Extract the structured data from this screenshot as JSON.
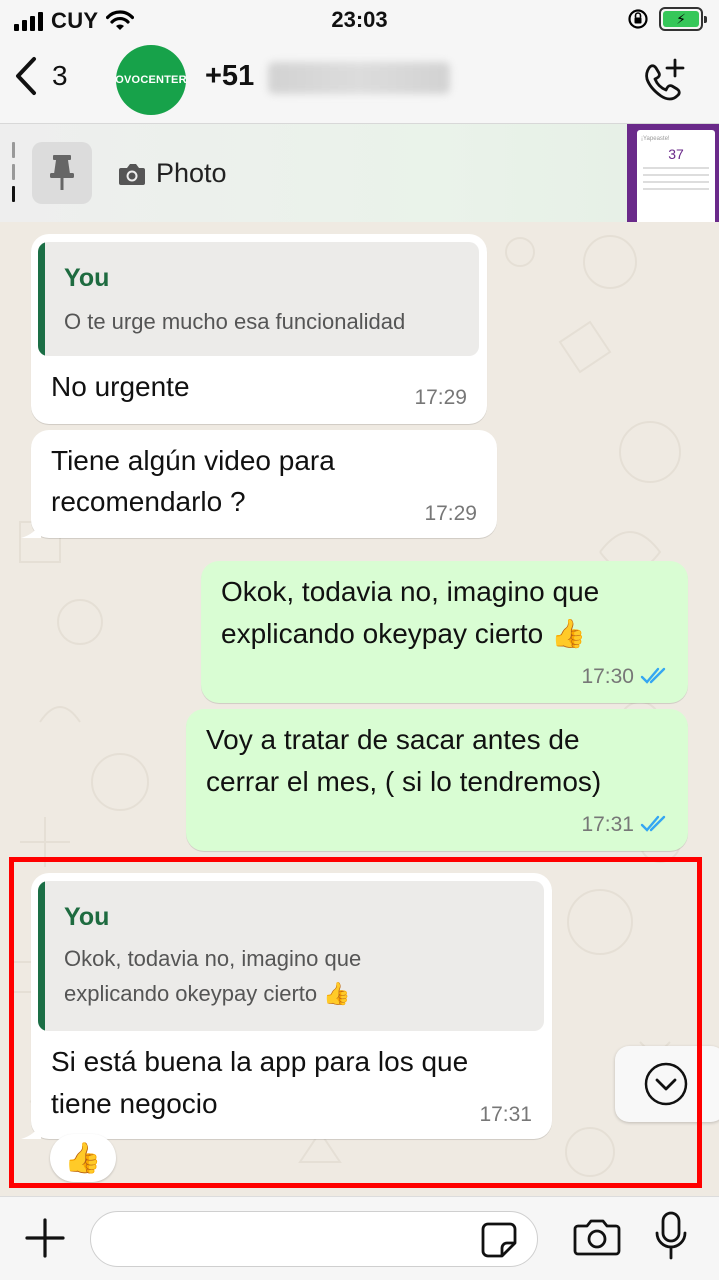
{
  "status_bar": {
    "carrier": "CUY",
    "time": "23:03",
    "battery_charging": true
  },
  "header": {
    "back_count": "3",
    "avatar_text": "OVOCENTER",
    "contact_name": "+51"
  },
  "pinned": {
    "preview_label": "Photo",
    "thumb_number": "37"
  },
  "messages": [
    {
      "id": "m1",
      "direction": "in",
      "quote_author": "You",
      "quote_text": "O te urge mucho esa funcionalidad",
      "text": "No urgente",
      "time": "17:29"
    },
    {
      "id": "m2",
      "direction": "in",
      "text_line1": "Tiene algún video para",
      "text_line2": "recomendarlo ?",
      "time": "17:29"
    },
    {
      "id": "m3",
      "direction": "out",
      "text_line1": "Okok, todavia no, imagino que",
      "text_line2": "explicando okeypay cierto 👍",
      "time": "17:30",
      "status": "read"
    },
    {
      "id": "m4",
      "direction": "out",
      "text_line1": "Voy a tratar de sacar antes de",
      "text_line2": "cerrar el mes, ( si lo tendremos)",
      "time": "17:31",
      "status": "read"
    },
    {
      "id": "m5",
      "direction": "in",
      "quote_author": "You",
      "quote_line1": "Okok, todavia no, imagino que",
      "quote_line2": "explicando okeypay cierto 👍",
      "text_line1": "Si está buena la app para los que",
      "text_line2": "tiene negocio",
      "time": "17:31",
      "reaction": "👍"
    }
  ],
  "composer": {
    "value": "",
    "placeholder": ""
  },
  "colors": {
    "outgoing_bubble": "#d9fdd3",
    "incoming_bubble": "#ffffff",
    "quote_accent": "#1b6e45",
    "read_ticks": "#34a6f2",
    "highlight": "#ff0000"
  },
  "icons": [
    "back-chevron-icon",
    "call-add-icon",
    "pin-icon",
    "camera-icon",
    "plus-icon",
    "sticker-icon",
    "mic-icon",
    "chevron-down-icon",
    "double-check-icon"
  ]
}
